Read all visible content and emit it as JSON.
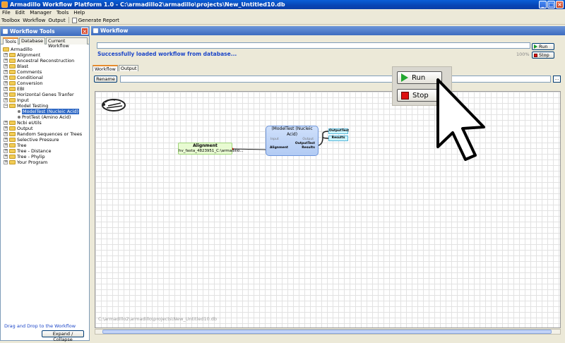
{
  "window": {
    "title": "Armadillo Workflow Platform 1.0 - C:\\armadillo2\\armadillo\\projects\\New_Untitled10.db"
  },
  "menubar": {
    "items": [
      "File",
      "Edit",
      "Manager",
      "Tools",
      "Help"
    ]
  },
  "toolbar": {
    "items": [
      "Toolbox",
      "Workflow",
      "Output"
    ],
    "report_label": "Generate Report"
  },
  "left_panel": {
    "title": "Workflow Tools",
    "tabs": [
      "Tools",
      "Database",
      "Current Workflow"
    ],
    "tree": {
      "root": "Armadillo",
      "items": [
        "Alignment",
        "Ancestral Reconstruction",
        "Blast",
        "Comments",
        "Conditional",
        "Conversion",
        "EBI",
        "Horizontal Genes Tranfer",
        "Input",
        "Model Testing",
        "Ncbi eUtils",
        "Output",
        "Random Sequences or Trees",
        "Selective Pressure",
        "Tree",
        "Tree - Distance",
        "Tree - Phylip",
        "Your Program"
      ],
      "model_testing_children": [
        "ModelTest (Nucleic Acid)",
        "ProtTest (Amino Acid)"
      ]
    },
    "hint": "Drag and Drop to the Workflow",
    "expand_button": "Expand / Collapse"
  },
  "workflow": {
    "title": "Workflow",
    "status": "Successfully loaded workflow from database...",
    "progress_percent": "100%",
    "progress_value": 100,
    "run_label": "Run",
    "stop_label": "Stop",
    "tabs": [
      "Workflow",
      "Output"
    ],
    "rename_label": "Rename",
    "more_label": "...",
    "canvas_path": "C:\\armadillo2\\armadillo\\projects\\New_Untitled10.db",
    "nodes": {
      "alignment": {
        "title": "Alignment",
        "subtitle": "hv_fasta_4823951_C:\\armadillo..."
      },
      "modeltest": {
        "title": "(ModelTest (Nucleic Acid)",
        "input": "Input",
        "output": "Output",
        "in_port": "Alignment",
        "out_port1": "OutputTest",
        "out_port2": "Results"
      },
      "out1": "OutputTest",
      "out2": "Results"
    }
  },
  "popup": {
    "run_label": "Run",
    "stop_label": "Stop"
  },
  "colors": {
    "title_bar": "#0745b5",
    "status_text": "#1c46c8",
    "selection": "#316ac5",
    "alignment_node": "#e8fbd2",
    "model_node": "#b2cbf4"
  }
}
